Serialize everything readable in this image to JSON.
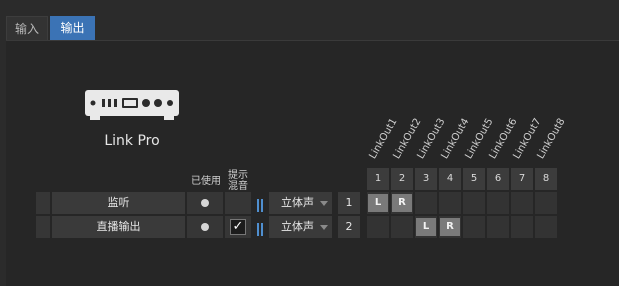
{
  "tabs": [
    {
      "label": "输入",
      "active": false
    },
    {
      "label": "输出",
      "active": true
    }
  ],
  "device": {
    "name": "Link Pro",
    "icon": "audio-interface-icon"
  },
  "headers": {
    "used": "已使用",
    "cue_line1": "提示",
    "cue_line2": "混音"
  },
  "outputs": [
    "LinkOut1",
    "LinkOut2",
    "LinkOut3",
    "LinkOut4",
    "LinkOut5",
    "LinkOut6",
    "LinkOut7",
    "LinkOut8"
  ],
  "output_numbers": [
    "1",
    "2",
    "3",
    "4",
    "5",
    "6",
    "7",
    "8"
  ],
  "rows": [
    {
      "name": "监听",
      "used": true,
      "cue": false,
      "mode": "立体声",
      "channel": "1",
      "assign": [
        "L",
        "R",
        "",
        "",
        "",
        "",
        "",
        ""
      ]
    },
    {
      "name": "直播输出",
      "used": true,
      "cue": true,
      "mode": "立体声",
      "channel": "2",
      "assign": [
        "",
        "",
        "L",
        "R",
        "",
        "",
        "",
        ""
      ]
    }
  ],
  "colors": {
    "accent": "#3b73b5",
    "meter": "#4f8fd0"
  }
}
